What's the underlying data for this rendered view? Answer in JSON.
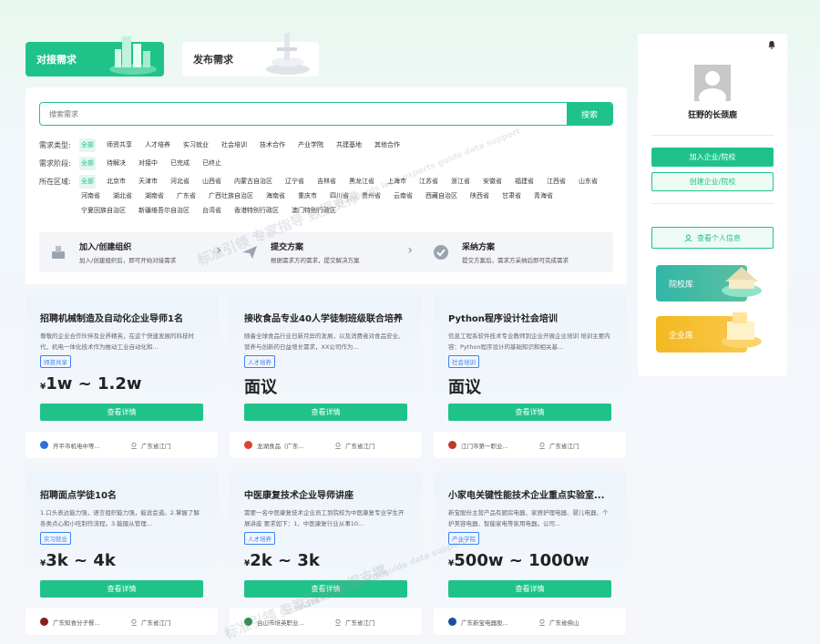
{
  "tabs": {
    "active": "对接需求",
    "inactive": "发布需求"
  },
  "search": {
    "placeholder": "搜索需求",
    "button": "搜索"
  },
  "filters": [
    {
      "label": "需求类型:",
      "options": [
        "全部",
        "师资共享",
        "人才培养",
        "实习就业",
        "社会培训",
        "技术合作",
        "产业学院",
        "共建基地",
        "其他合作"
      ],
      "selected": 0
    },
    {
      "label": "需求阶段:",
      "options": [
        "全部",
        "待解决",
        "对接中",
        "已完成",
        "已终止"
      ],
      "selected": 0
    },
    {
      "label": "所在区域:",
      "options": [
        "全部",
        "北京市",
        "天津市",
        "河北省",
        "山西省",
        "内蒙古自治区",
        "辽宁省",
        "吉林省",
        "黑龙江省",
        "上海市",
        "江苏省",
        "浙江省",
        "安徽省",
        "福建省",
        "江西省",
        "山东省",
        "河南省",
        "湖北省",
        "湖南省",
        "广东省",
        "广西壮族自治区",
        "海南省",
        "重庆市",
        "四川省",
        "贵州省",
        "云南省",
        "西藏自治区",
        "陕西省",
        "甘肃省",
        "青海省",
        "宁夏回族自治区",
        "新疆维吾尔自治区",
        "台湾省",
        "香港特别行政区",
        "澳门特别行政区"
      ],
      "selected": 0
    }
  ],
  "steps": [
    {
      "title": "加入/创建组织",
      "desc": "加入/创建组织后，即可开始对接需求"
    },
    {
      "title": "提交方案",
      "desc": "根据需求方的需求，提交解决方案"
    },
    {
      "title": "采纳方案",
      "desc": "提交方案后，需求方采纳后即可完成需求"
    }
  ],
  "cards": [
    {
      "title": "招聘机械制造及自动化企业导师1名",
      "desc": "尊敬的企业合作伙伴及业界精英，在这个快速发展的科技时代，机电一体化技术作为推动工业自动化和...",
      "tag": "师资共享",
      "price_prefix": "¥",
      "price": "1w ~ 1.2w",
      "org": "开平市机电中等...",
      "location": "广东省江门",
      "logo_color": "#2f6fd6",
      "button": "查看详情"
    },
    {
      "title": "接收食品专业40人学徒制班级联合培养",
      "desc": "随着全球食品行业日新月异的发展，以及消费者对食品安全、营养与创新的日益增长需求，XX公司作为...",
      "tag": "人才培养",
      "price_prefix": "",
      "price": "面议",
      "org": "龙湖食品（广东...",
      "location": "广东省江门",
      "logo_color": "#d9452b",
      "button": "查看详情"
    },
    {
      "title": "Python程序设计社会培训",
      "desc": "信息工程系软件技术专业教师到企业开展企业培训 培训主要内容：Python程序设计的基础知识和相关基...",
      "tag": "社会培训",
      "price_prefix": "",
      "price": "面议",
      "org": "江门市第一职业...",
      "location": "广东省江门",
      "logo_color": "#c0392b",
      "button": "查看详情"
    },
    {
      "title": "招聘面点学徒10名",
      "desc": "1.口头表达能力强，语言组织能力强，能说会道。2.掌握了解各类点心和小吃制作流程。3.能服从管理...",
      "tag": "实习就业",
      "price_prefix": "¥",
      "price": "3k ~ 4k",
      "org": "广东知食分子餐...",
      "location": "广东省江门",
      "logo_color": "#8b1d1d",
      "button": "查看详情"
    },
    {
      "title": "中医康复技术企业导师讲座",
      "desc": "需要一名中医康复技术企业员工到院校为中医康复专业学生开展讲座 要求如下：1、中医康复行业从事10...",
      "tag": "人才培养",
      "price_prefix": "¥",
      "price": "2k ~ 3k",
      "org": "台山市培英职业...",
      "location": "广东省江门",
      "logo_color": "#2e8b57",
      "button": "查看详情"
    },
    {
      "title": "小家电关键性能技术企业重点实验室...",
      "desc": "新宝股份主营产品有厨房电器、家居护理电器、婴儿电器、个护美容电器、智能家电等家用电器。公司...",
      "tag": "产业学院",
      "price_prefix": "¥",
      "price": "500w ~ 1000w",
      "org": "广东新宝电器股...",
      "location": "广东省佛山",
      "logo_color": "#1f4e9c",
      "button": "查看详情"
    }
  ],
  "sidebar": {
    "username": "狂野的长颈鹿",
    "join_button": "加入企业/院校",
    "create_button": "创建企业/院校",
    "profile_button": "查看个人信息",
    "school_lib": "院校库",
    "enterprise_lib": "企业库"
  },
  "colors": {
    "accent": "#1fc38a",
    "tag_blue": "#3b82f6"
  }
}
